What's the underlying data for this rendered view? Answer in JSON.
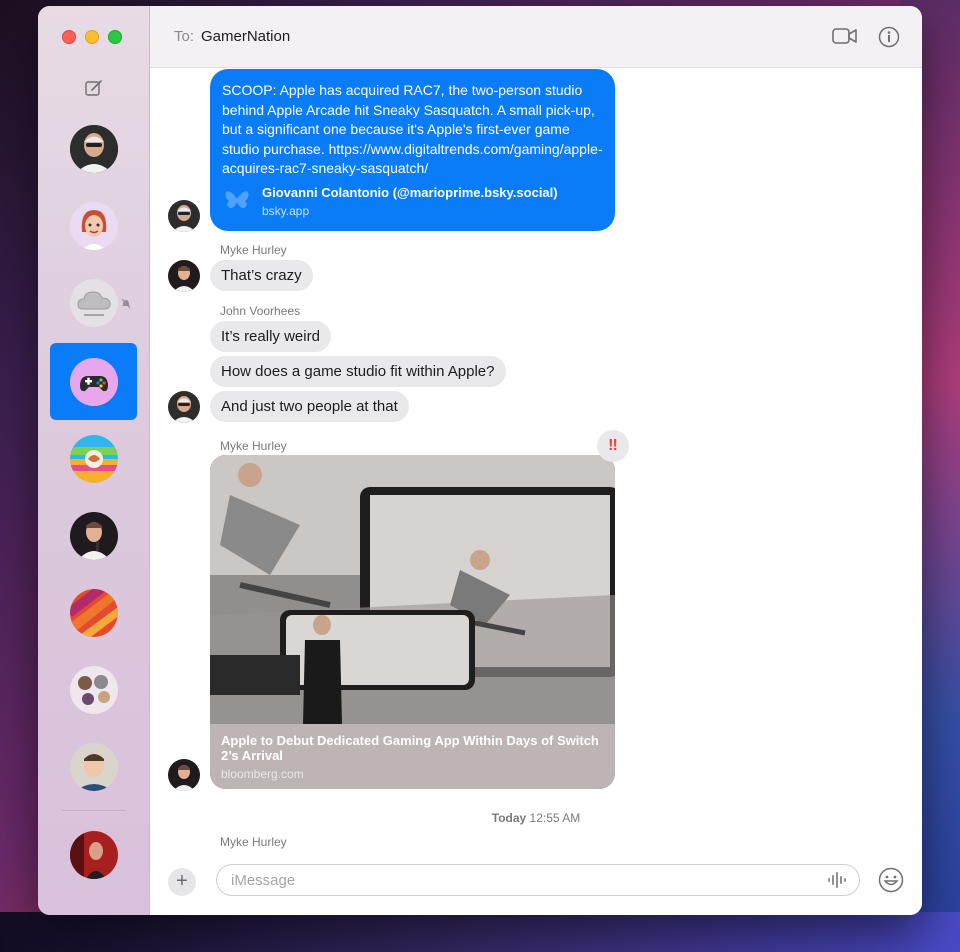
{
  "header": {
    "to_label": "To:",
    "recipient": "GamerNation",
    "icons": [
      "video-camera-icon",
      "info-icon"
    ]
  },
  "sidebar": {
    "compose_icon": "compose-icon",
    "conversations": [
      {
        "name": "conversation-1",
        "avatar": "photo-bald-man"
      },
      {
        "name": "conversation-2",
        "avatar": "memoji-redhead"
      },
      {
        "name": "conversation-3",
        "avatar": "cloud-icon",
        "muted": true
      },
      {
        "name": "conversation-gamernation",
        "avatar": "gamepad-icon",
        "selected": true
      },
      {
        "name": "conversation-5",
        "avatar": "globe-sticker"
      },
      {
        "name": "conversation-6",
        "avatar": "photo-man-mic"
      },
      {
        "name": "conversation-7",
        "avatar": "stripes-art"
      },
      {
        "name": "conversation-8",
        "avatar": "group-photos"
      },
      {
        "name": "conversation-9",
        "avatar": "photo-young-man"
      },
      {
        "name": "conversation-10",
        "avatar": "photo-red-room"
      }
    ]
  },
  "messages": {
    "m1": {
      "text": "SCOOP: Apple has acquired RAC7, the two-person studio behind Apple Arcade hit Sneaky Sasquatch. A small pick-up, but a significant one because it's Apple's first-ever game studio purchase. https://www.digitaltrends.com/gaming/apple-acquires-rac7-sneaky-sasquatch/",
      "link_title": "Giovanni Colantonio (@marioprime.bsky.social)",
      "link_source": "bsky.app"
    },
    "m2": {
      "sender": "Myke Hurley",
      "text": "That’s crazy"
    },
    "m3": {
      "sender": "John Voorhees",
      "text": "It’s really weird"
    },
    "m4": {
      "text": "How does a game studio fit within Apple?"
    },
    "m5": {
      "text": "And just two people at that"
    },
    "m6": {
      "sender": "Myke Hurley",
      "tapback": "‼",
      "link_title": "Apple to Debut Dedicated Gaming App Within Days of Switch 2’s Arrival",
      "link_source": "bloomberg.com"
    },
    "timestamp_day": "Today",
    "timestamp_time": "12:55 AM",
    "m7": {
      "sender": "Myke Hurley"
    }
  },
  "composer": {
    "placeholder": "iMessage",
    "value": ""
  },
  "colors": {
    "accent_blue": "#0a7cf8",
    "bubble_gray": "#e9e9eb",
    "traffic_red": "#ff5f57",
    "traffic_yellow": "#febc2e",
    "traffic_green": "#28c840"
  }
}
